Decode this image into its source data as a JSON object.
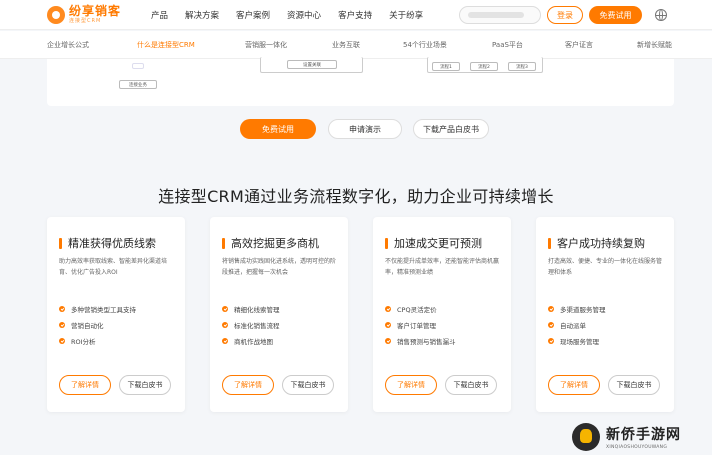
{
  "brand": {
    "name": "纷享销客",
    "subtitle": "连接型CRM",
    "accent": "#ff7a00"
  },
  "topnav": {
    "links": [
      "产品",
      "解决方案",
      "客户案例",
      "资源中心",
      "客户支持",
      "关于纷享"
    ],
    "login": "登录",
    "trial": "免费试用"
  },
  "subnav": {
    "items": [
      "企业增长公式",
      "什么是连接型CRM",
      "营销服一体化",
      "业务互联",
      "54个行业场景",
      "PaaS平台",
      "客户证言",
      "新增长赋能"
    ],
    "active_index": 1
  },
  "panel": {
    "labels": [
      "连接业务",
      "设置关联",
      "流程1",
      "流程2",
      "流程3"
    ]
  },
  "actions": {
    "trial": "免费试用",
    "demo": "申请演示",
    "whitepaper": "下载产品白皮书"
  },
  "headline": "连接型CRM通过业务流程数字化，助力企业可持续增长",
  "cards": [
    {
      "title": "精准获得优质线索",
      "desc": "助力高效率获取线索、智能差异化渠道培育、优化广告投入ROI",
      "features": [
        "多种营销类型工具支持",
        "营销自动化",
        "ROI分析"
      ],
      "more": "了解详情",
      "download": "下载白皮书"
    },
    {
      "title": "高效挖掘更多商机",
      "desc": "将销售成功实践固化进系统，透明可控的阶段推进，把握每一次机会",
      "features": [
        "精细化线索管理",
        "标准化销售流程",
        "商机作战地图"
      ],
      "more": "了解详情",
      "download": "下载白皮书"
    },
    {
      "title": "加速成交更可预测",
      "desc": "不仅能提升成单效率，还能智能评估商机赢率，精准预测业绩",
      "features": [
        "CPQ灵活定价",
        "客户订单管理",
        "销售预测与销售漏斗"
      ],
      "more": "了解详情",
      "download": "下载白皮书"
    },
    {
      "title": "客户成功持续复购",
      "desc": "打造高效、便捷、专业的一体化在线服务管理和体系",
      "features": [
        "多渠道服务管理",
        "自动派单",
        "现场服务管理"
      ],
      "more": "了解详情",
      "download": "下载白皮书"
    }
  ],
  "watermark": {
    "title": "新侨手游网",
    "sub": "XINQIAOSHOUYOUWANG"
  }
}
